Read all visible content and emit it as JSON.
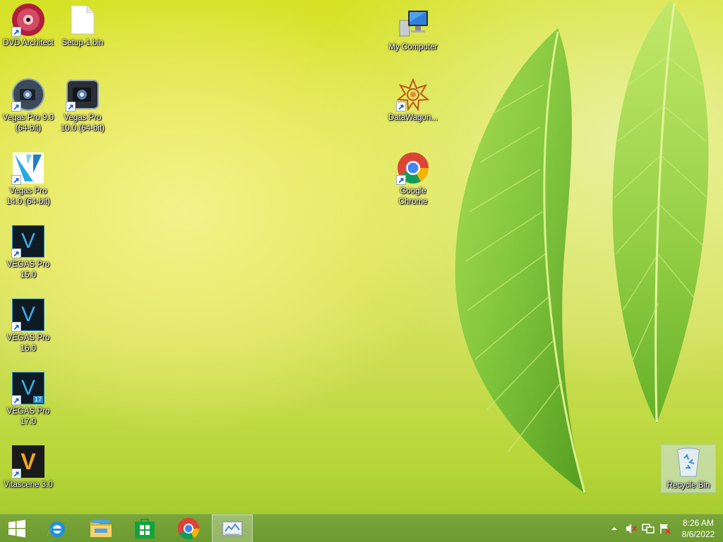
{
  "desktop": {
    "icons": [
      {
        "id": "dvd-architect",
        "label": "DVD Architect",
        "shortcut": true,
        "icon": "dvd-disc-icon"
      },
      {
        "id": "setup-1-bin",
        "label": "Setup-1.bin",
        "shortcut": false,
        "icon": "blank-file-icon"
      },
      {
        "id": "vegas-pro-9",
        "label": "Vegas Pro 9.0 (64-bit)",
        "shortcut": true,
        "icon": "vegas-camera-icon"
      },
      {
        "id": "vegas-pro-10",
        "label": "Vegas Pro 10.0 (64-bit)",
        "shortcut": true,
        "icon": "vegas-camera-icon"
      },
      {
        "id": "vegas-pro-14",
        "label": "Vegas Pro 14.0 (64-bit)",
        "shortcut": true,
        "icon": "vegas-14-icon"
      },
      {
        "id": "vegas-pro-15",
        "label": "VEGAS Pro 15.0",
        "shortcut": true,
        "icon": "vegas-v-icon",
        "glyph": "V"
      },
      {
        "id": "vegas-pro-16",
        "label": "VEGAS Pro 16.0",
        "shortcut": true,
        "icon": "vegas-v-icon",
        "glyph": "V"
      },
      {
        "id": "vegas-pro-17",
        "label": "VEGAS Pro 17.0",
        "shortcut": true,
        "icon": "vegas-v17-icon",
        "glyph": "V",
        "badge": "17"
      },
      {
        "id": "vitascene-3",
        "label": "Vitascene 3.0",
        "shortcut": true,
        "icon": "vitascene-icon",
        "glyph": "V"
      },
      {
        "id": "my-computer",
        "label": "My Computer",
        "shortcut": false,
        "icon": "computer-icon"
      },
      {
        "id": "datawagon",
        "label": "DataWagon...",
        "shortcut": true,
        "icon": "datawagon-icon"
      },
      {
        "id": "google-chrome",
        "label": "Google Chrome",
        "shortcut": true,
        "icon": "chrome-icon"
      },
      {
        "id": "recycle-bin",
        "label": "Recycle Bin",
        "shortcut": false,
        "icon": "recycle-bin-icon",
        "selected": true
      }
    ]
  },
  "taskbar": {
    "buttons": [
      {
        "id": "start",
        "icon": "windows-start-icon"
      },
      {
        "id": "internet-explorer",
        "icon": "internet-explorer-icon"
      },
      {
        "id": "file-explorer",
        "icon": "file-explorer-icon"
      },
      {
        "id": "store",
        "icon": "windows-store-icon"
      },
      {
        "id": "chrome",
        "icon": "chrome-icon"
      },
      {
        "id": "control-panel",
        "icon": "control-panel-icon",
        "active": true
      }
    ],
    "tray": {
      "icons": [
        "tray-chevron-icon",
        "speaker-muted-icon",
        "network-icon",
        "action-center-flag-icon"
      ],
      "time": "8:26 AM",
      "date": "8/6/2022"
    }
  },
  "colors": {
    "taskbar": "#6c9a2f",
    "leaf": "#7cc33a",
    "chrome_red": "#db4437",
    "chrome_yellow": "#f4b400",
    "chrome_green": "#0f9d58",
    "chrome_blue": "#4285f4",
    "vegas_blue": "#29a8e0"
  }
}
